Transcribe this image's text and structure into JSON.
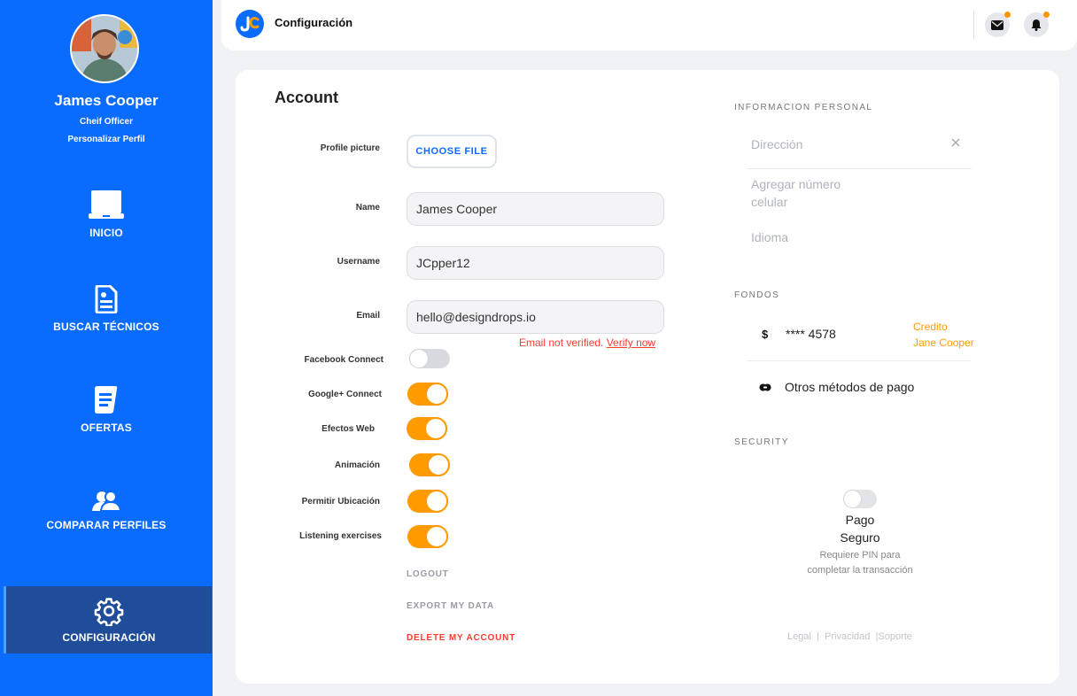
{
  "profile": {
    "name": "James Cooper",
    "role": "Cheif Officer",
    "edit_link": "Personalizar Perfil"
  },
  "nav": [
    {
      "label": "INICIO",
      "icon": "laptop-icon"
    },
    {
      "label": "BUSCAR TÉCNICOS",
      "icon": "document-icon"
    },
    {
      "label": "OFERTAS",
      "icon": "notes-icon"
    },
    {
      "label": "COMPARAR PERFILES",
      "icon": "users-icon"
    },
    {
      "label": "CONFIGURACIÓN",
      "icon": "gear-icon",
      "active": true
    }
  ],
  "topbar": {
    "title": "Configuración",
    "mail_icon": "mail-icon",
    "bell_icon": "bell-icon",
    "notification_color": "#ff9500"
  },
  "account": {
    "title": "Account",
    "profile_picture_label": "Profile picture",
    "choose_file_label": "CHOOSE FILE",
    "name_label": "Name",
    "name_value": "James Cooper",
    "username_label": "Username",
    "username_value": "JCpper12",
    "email_label": "Email",
    "email_value": "hello@designdrops.io",
    "email_warning": "Email not verified.",
    "verify_link": "Verify now",
    "toggles": [
      {
        "label": "Facebook Connect",
        "on": false
      },
      {
        "label": "Google+ Connect",
        "on": true
      },
      {
        "label": "Efectos Web",
        "on": true
      },
      {
        "label": "Animación",
        "on": true
      },
      {
        "label": "Permitir Ubicación",
        "on": true
      },
      {
        "label": "Listening exercises",
        "on": true
      }
    ],
    "logout": "LOGOUT",
    "export": "EXPORT MY DATA",
    "delete": "DELETE MY ACCOUNT"
  },
  "personal": {
    "heading": "INFORMACION PERSONAL",
    "address_placeholder": "Dirección",
    "phone_placeholder_line1": "Agregar número",
    "phone_placeholder_line2": "celular",
    "language_placeholder": "Idioma"
  },
  "funds": {
    "heading": "FONDOS",
    "currency_symbol": "$",
    "card_number": "**** 4578",
    "card_type": "Credito",
    "card_holder": "Jane Cooper",
    "other_methods": "Otros métodos de pago"
  },
  "security": {
    "heading": "SECURITY",
    "toggle_title_line1": "Pago",
    "toggle_title_line2": "Seguro",
    "toggle_desc_line1": "Requiere PIN para",
    "toggle_desc_line2": "completar la transacción",
    "toggle_on": false
  },
  "footer": {
    "legal": "Legal",
    "privacy": "Privacidad",
    "support": "Soporte",
    "sep1": "|",
    "sep2": "|"
  },
  "colors": {
    "primary": "#0a6cff",
    "sidebar_active": "#1f4d99",
    "accent_orange": "#ff9b00",
    "danger": "#ff3b30"
  }
}
